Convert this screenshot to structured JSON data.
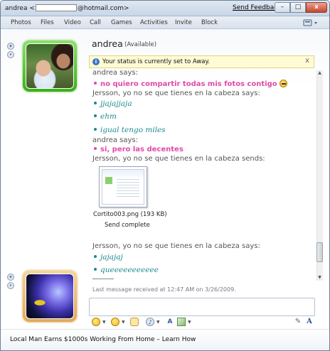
{
  "window": {
    "title_prefix": "andrea <",
    "title_suffix": "@hotmail.com>",
    "send_feedback": "Send Feedback",
    "min_glyph": "–",
    "max_glyph": "□",
    "close_glyph": "x"
  },
  "menu": {
    "items": [
      "Photos",
      "Files",
      "Video",
      "Call",
      "Games",
      "Activities",
      "Invite",
      "Block"
    ],
    "options_icon": "menu-options-icon"
  },
  "contact": {
    "name": "andrea",
    "status": "(Available)"
  },
  "info_bar": {
    "text": "Your status is currently set to Away.",
    "close": "x"
  },
  "conversation": [
    {
      "type": "says",
      "text": "andrea says:"
    },
    {
      "type": "msg",
      "style": "pink",
      "text": "no quiero compartir todas mis fotos contigo"
    },
    {
      "type": "says",
      "text": "Jersson, yo no se que tienes en la cabeza says:"
    },
    {
      "type": "msg",
      "style": "teal",
      "text": "jjajajjaja"
    },
    {
      "type": "msg",
      "style": "teal",
      "text": "ehm"
    },
    {
      "type": "msg",
      "style": "teal",
      "text": "igual tengo miles"
    },
    {
      "type": "says",
      "text": "andrea says:"
    },
    {
      "type": "msg",
      "style": "pink",
      "text": "si, pero las decentes"
    },
    {
      "type": "says",
      "text": "Jersson, yo no se que tienes en la cabeza sends:"
    },
    {
      "type": "says",
      "text": "Jersson, yo no se que tienes en la cabeza says:"
    },
    {
      "type": "msg",
      "style": "teal",
      "text": "jajajaj"
    },
    {
      "type": "msg",
      "style": "teal",
      "text": "queeeeeeeeeee"
    }
  ],
  "file_transfer": {
    "file_name": "Cortito003.png (193 KB)",
    "status": "Send complete"
  },
  "last_message": "Last message received at 12:47 AM on 3/26/2009.",
  "input": {
    "value": ""
  },
  "footer": {
    "ad_text": "Local Man Earns $1000s Working From Home – Learn How"
  },
  "colors": {
    "pink_message": "#e04aa9",
    "teal_message": "#1f8a8c",
    "status_available": "#39b019",
    "info_bar_bg": "#fffbd6"
  }
}
